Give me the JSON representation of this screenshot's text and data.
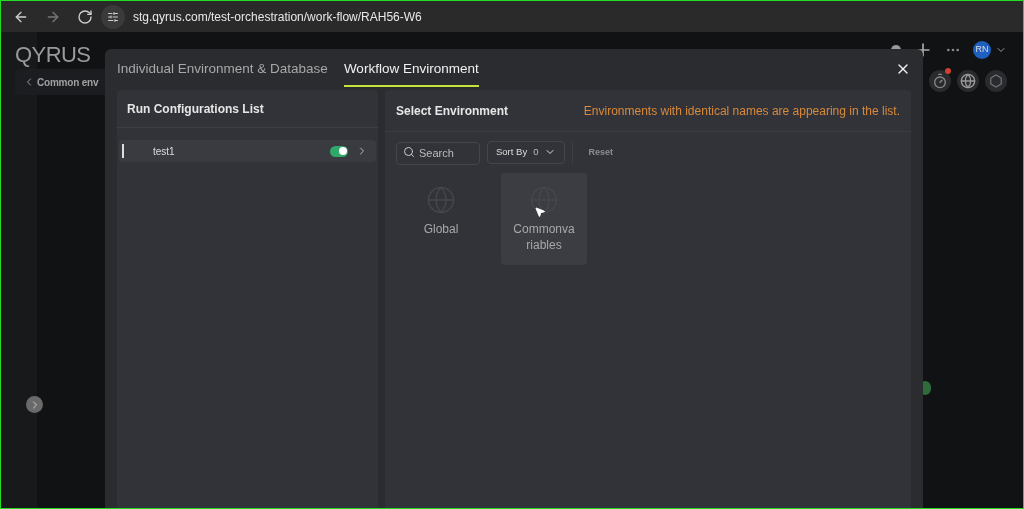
{
  "browser": {
    "url": "stg.qyrus.com/test-orchestration/work-flow/RAH56-W6"
  },
  "app": {
    "logo": "QYRUS",
    "breadcrumb": "Common env",
    "avatar": "RN",
    "timer_notification": true
  },
  "dialog": {
    "tabs": [
      {
        "label": "Individual Environment & Database",
        "selected": false
      },
      {
        "label": "Workflow Environment",
        "selected": true
      }
    ],
    "left_panel": {
      "title": "Run Configurations List",
      "items": [
        {
          "name": "test1",
          "on": true
        }
      ]
    },
    "right_panel": {
      "title": "Select Environment",
      "warning": "Environments with identical names are appearing in the list.",
      "search": {
        "placeholder": "Search"
      },
      "sort": {
        "label": "Sort By",
        "count": "0"
      },
      "reset": "Reset",
      "environments": [
        {
          "name": "Global",
          "highlighted": false
        },
        {
          "name": "Commonva\nriables",
          "highlighted": true
        }
      ]
    }
  }
}
